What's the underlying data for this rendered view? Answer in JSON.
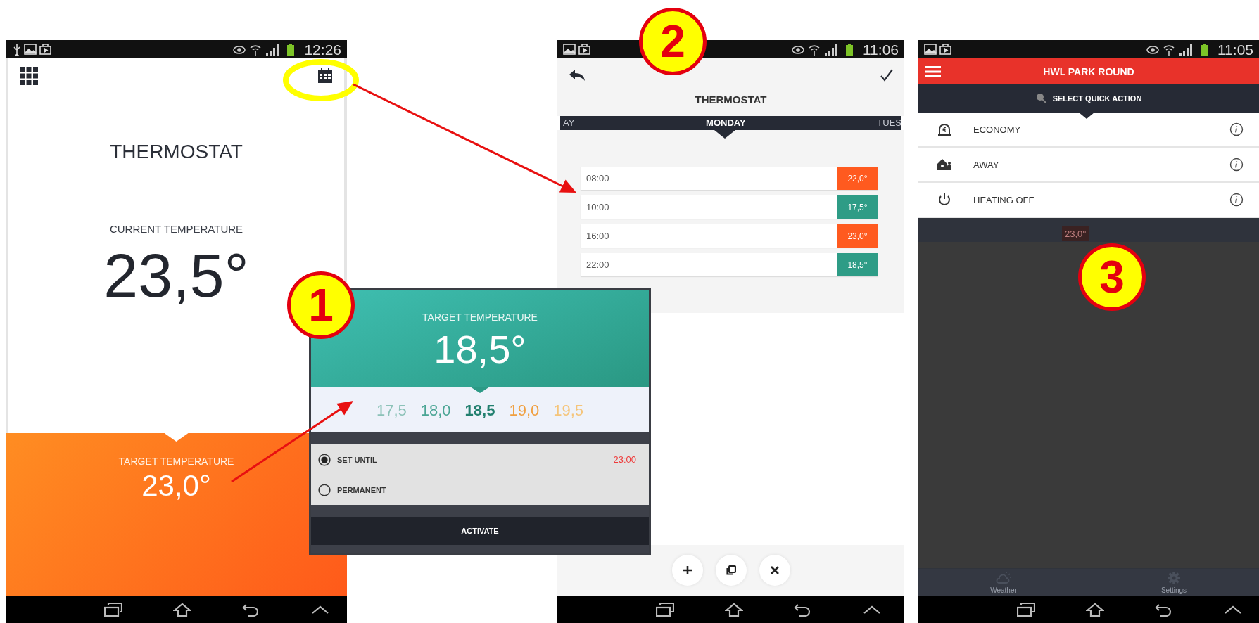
{
  "home_screen": {
    "status_time": "12:26",
    "title": "THERMOSTAT",
    "current_label": "CURRENT TEMPERATURE",
    "current_value": "23,5°",
    "target_label": "TARGET TEMPERATURE",
    "target_value": "23,0°"
  },
  "schedule_screen": {
    "status_time": "11:06",
    "title": "THERMOSTAT",
    "days": [
      {
        "label": "AY",
        "selected": false
      },
      {
        "label": "MONDAY",
        "selected": true
      },
      {
        "label": "TUES",
        "selected": false
      }
    ],
    "entries": [
      {
        "time": "08:00",
        "temperature": "22,0°",
        "color": "#ff5a1f"
      },
      {
        "time": "10:00",
        "temperature": "17,5°",
        "color": "#2e9c86"
      },
      {
        "time": "16:00",
        "temperature": "23,0°",
        "color": "#ff5a1f"
      },
      {
        "time": "22:00",
        "temperature": "18,5°",
        "color": "#2e9c86"
      }
    ],
    "actions": [
      {
        "kind": "add"
      },
      {
        "kind": "copy"
      },
      {
        "kind": "delete"
      }
    ]
  },
  "quick_action_screen": {
    "status_time": "11:05",
    "header": "HWL PARK ROUND",
    "prompt": "SELECT QUICK ACTION",
    "actions": [
      {
        "kind": "economy",
        "label": "ECONOMY"
      },
      {
        "kind": "away",
        "label": "AWAY"
      },
      {
        "kind": "power",
        "label": "HEATING OFF"
      }
    ],
    "background_reading": "23,0°",
    "tabs": [
      {
        "kind": "weather",
        "label": "Weather"
      },
      {
        "kind": "settings",
        "label": "Settings"
      }
    ]
  },
  "target_popup": {
    "label": "TARGET TEMPERATURE",
    "value": "18,5°",
    "options": [
      {
        "value": "17,5",
        "color": "#8cc2b8",
        "selected": false
      },
      {
        "value": "18,0",
        "color": "#4aa594",
        "selected": false
      },
      {
        "value": "18,5",
        "color": "#22806f",
        "selected": true
      },
      {
        "value": "19,0",
        "color": "#f0a040",
        "selected": false
      },
      {
        "value": "19,5",
        "color": "#f5c57a",
        "selected": false
      }
    ],
    "modes": [
      {
        "label": "SET UNTIL",
        "time": "23:00",
        "selected": true
      },
      {
        "label": "PERMANENT",
        "selected": false
      }
    ],
    "button": "ACTIVATE"
  },
  "callouts": [
    {
      "number": "1"
    },
    {
      "number": "2"
    },
    {
      "number": "3"
    }
  ]
}
